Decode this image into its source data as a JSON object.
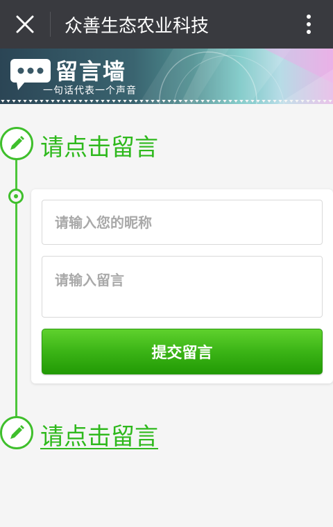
{
  "app": {
    "title": "众善生态农业科技"
  },
  "banner": {
    "title": "留言墙",
    "slogan": "一句话代表一个声音"
  },
  "timeline": {
    "heading_top": "请点击留言",
    "heading_bottom": "请点击留言"
  },
  "form": {
    "nickname_placeholder": "请输入您的昵称",
    "nickname_value": "",
    "message_placeholder": "请输入留言",
    "message_value": "",
    "submit_label": "提交留言"
  },
  "colors": {
    "accent_green": "#3fbf2c",
    "topbar": "#393a3f"
  },
  "icons": {
    "close": "close-icon",
    "more": "more-vertical-icon",
    "chat_bubble": "chat-bubble-icon",
    "pencil": "pencil-icon"
  }
}
